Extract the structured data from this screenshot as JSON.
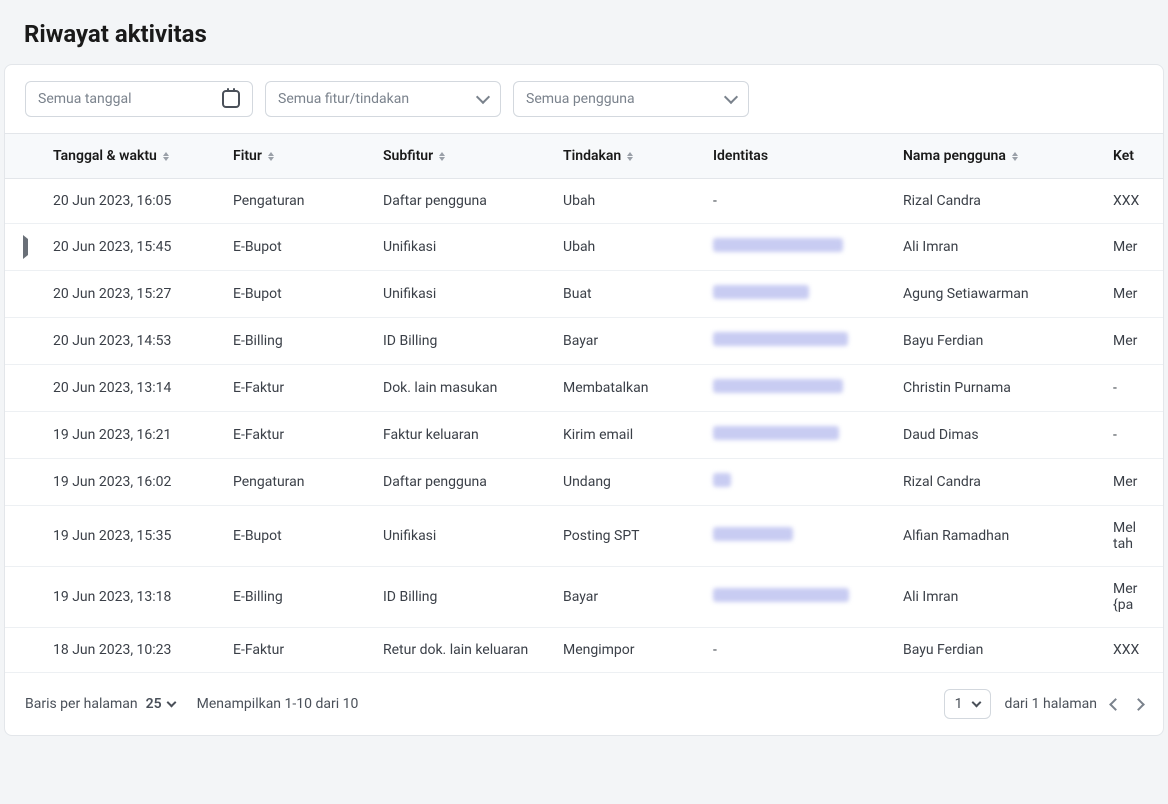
{
  "page": {
    "title": "Riwayat aktivitas"
  },
  "filters": {
    "date_placeholder": "Semua tanggal",
    "feature_placeholder": "Semua fitur/tindakan",
    "user_placeholder": "Semua pengguna"
  },
  "columns": {
    "datetime": "Tanggal & waktu",
    "feature": "Fitur",
    "subfeature": "Subfitur",
    "action": "Tindakan",
    "identity": "Identitas",
    "username": "Nama pengguna",
    "note": "Ket"
  },
  "rows": [
    {
      "expandable": false,
      "datetime": "20 Jun 2023, 16:05",
      "feature": "Pengaturan",
      "subfeature": "Daftar pengguna",
      "action": "Ubah",
      "identity": "-",
      "blur_width": 0,
      "username": "Rizal Candra",
      "note": "XXX"
    },
    {
      "expandable": true,
      "datetime": "20 Jun 2023, 15:45",
      "feature": "E-Bupot",
      "subfeature": "Unifikasi",
      "action": "Ubah",
      "identity": "",
      "blur_width": 130,
      "username": "Ali Imran",
      "note": "Mer"
    },
    {
      "expandable": false,
      "datetime": "20 Jun 2023, 15:27",
      "feature": "E-Bupot",
      "subfeature": "Unifikasi",
      "action": "Buat",
      "identity": "",
      "blur_width": 96,
      "username": "Agung Setiawarman",
      "note": "Mer"
    },
    {
      "expandable": false,
      "datetime": "20 Jun 2023, 14:53",
      "feature": "E-Billing",
      "subfeature": "ID Billing",
      "action": "Bayar",
      "identity": "",
      "blur_width": 135,
      "username": "Bayu Ferdian",
      "note": "Mer"
    },
    {
      "expandable": false,
      "datetime": "20 Jun 2023, 13:14",
      "feature": "E-Faktur",
      "subfeature": "Dok. lain masukan",
      "action": "Membatalkan",
      "identity": "",
      "blur_width": 130,
      "username": "Christin Purnama",
      "note": "-"
    },
    {
      "expandable": false,
      "datetime": "19 Jun 2023, 16:21",
      "feature": "E-Faktur",
      "subfeature": "Faktur keluaran",
      "action": "Kirim email",
      "identity": "",
      "blur_width": 126,
      "username": "Daud Dimas",
      "note": "-"
    },
    {
      "expandable": false,
      "datetime": "19 Jun 2023, 16:02",
      "feature": "Pengaturan",
      "subfeature": "Daftar pengguna",
      "action": "Undang",
      "identity": "",
      "blur_width": 18,
      "username": "Rizal Candra",
      "note": "Mer"
    },
    {
      "expandable": false,
      "datetime": "19 Jun 2023, 15:35",
      "feature": "E-Bupot",
      "subfeature": "Unifikasi",
      "action": "Posting SPT",
      "identity": "",
      "blur_width": 80,
      "username": "Alfian Ramadhan",
      "note": "Mel\ntah"
    },
    {
      "expandable": false,
      "datetime": "19 Jun 2023, 13:18",
      "feature": "E-Billing",
      "subfeature": "ID Billing",
      "action": "Bayar",
      "identity": "",
      "blur_width": 136,
      "username": "Ali Imran",
      "note": "Mer\n{pa"
    },
    {
      "expandable": false,
      "datetime": "18 Jun 2023, 10:23",
      "feature": "E-Faktur",
      "subfeature": "Retur dok. lain keluaran",
      "action": "Mengimpor",
      "identity": "-",
      "blur_width": 0,
      "username": "Bayu Ferdian",
      "note": "XXX"
    }
  ],
  "footer": {
    "rows_per_page_label": "Baris per halaman",
    "rows_per_page_value": "25",
    "showing": "Menampilkan 1-10 dari 10",
    "page_value": "1",
    "of_pages": "dari 1 halaman"
  }
}
